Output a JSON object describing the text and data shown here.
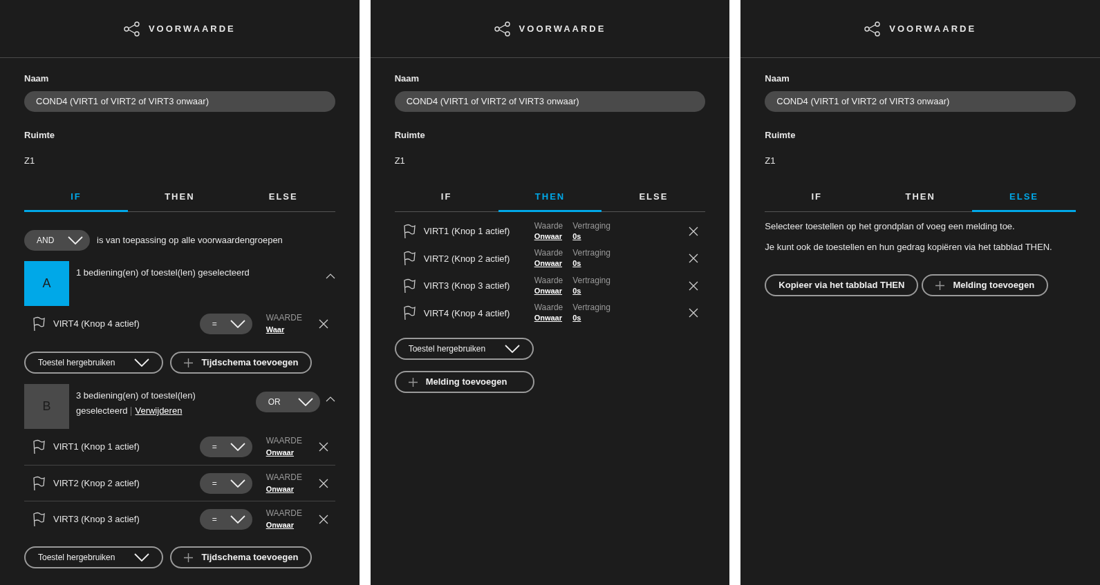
{
  "panels": [
    {
      "kind": "if",
      "title": "VOORWAARDE",
      "name_label": "Naam",
      "name_value": "COND4 (VIRT1 of VIRT2 of VIRT3 onwaar)",
      "room_label": "Ruimte",
      "room_value": "Z1",
      "tabs": [
        {
          "label": "IF",
          "selected": true
        },
        {
          "label": "THEN",
          "selected": false
        },
        {
          "label": "ELSE",
          "selected": false
        }
      ],
      "operator": "AND",
      "operator_text": "is van toepassing op alle voorwaardengroepen",
      "groups": [
        {
          "letter": "A",
          "color": "#00a8e8",
          "summary": "1 bediening(en) of toestel(len) geselecteerd",
          "expanded": true,
          "items": [
            {
              "name": "VIRT4 (Knop 4 actief)",
              "operator": "=",
              "value_label": "WAARDE",
              "value": "Waar"
            }
          ],
          "reuse_button": "Toestel hergebruiken",
          "add_button": "Tijdschema toevoegen"
        },
        {
          "letter": "B",
          "color": "#4a4a4a",
          "summary": "3 bediening(en) of toestel(len) geselecteerd",
          "remove_link": "Verwijderen",
          "operator": "OR",
          "expanded": true,
          "items": [
            {
              "name": "VIRT1 (Knop 1 actief)",
              "operator": "=",
              "value_label": "WAARDE",
              "value": "Onwaar"
            },
            {
              "name": "VIRT2 (Knop 2 actief)",
              "operator": "=",
              "value_label": "WAARDE",
              "value": "Onwaar"
            },
            {
              "name": "VIRT3 (Knop 3 actief)",
              "operator": "=",
              "value_label": "WAARDE",
              "value": "Onwaar"
            }
          ],
          "reuse_button": "Toestel hergebruiken",
          "add_button": "Tijdschema toevoegen"
        }
      ]
    },
    {
      "kind": "then",
      "title": "VOORWAARDE",
      "name_label": "Naam",
      "name_value": "COND4 (VIRT1 of VIRT2 of VIRT3 onwaar)",
      "room_label": "Ruimte",
      "room_value": "Z1",
      "tabs": [
        {
          "label": "IF",
          "selected": false
        },
        {
          "label": "THEN",
          "selected": true
        },
        {
          "label": "ELSE",
          "selected": false
        }
      ],
      "actions": [
        {
          "name": "VIRT1 (Knop 1 actief)",
          "value_label": "Waarde",
          "value": "Onwaar",
          "delay_label": "Vertraging",
          "delay": "0s"
        },
        {
          "name": "VIRT2 (Knop 2 actief)",
          "value_label": "Waarde",
          "value": "Onwaar",
          "delay_label": "Vertraging",
          "delay": "0s"
        },
        {
          "name": "VIRT3 (Knop 3 actief)",
          "value_label": "Waarde",
          "value": "Onwaar",
          "delay_label": "Vertraging",
          "delay": "0s"
        },
        {
          "name": "VIRT4 (Knop 4 actief)",
          "value_label": "Waarde",
          "value": "Onwaar",
          "delay_label": "Vertraging",
          "delay": "0s"
        }
      ],
      "reuse_button": "Toestel hergebruiken",
      "add_button": "Melding toevoegen"
    },
    {
      "kind": "else",
      "title": "VOORWAARDE",
      "name_label": "Naam",
      "name_value": "COND4 (VIRT1 of VIRT2 of VIRT3 onwaar)",
      "room_label": "Ruimte",
      "room_value": "Z1",
      "tabs": [
        {
          "label": "IF",
          "selected": false
        },
        {
          "label": "THEN",
          "selected": false
        },
        {
          "label": "ELSE",
          "selected": true
        }
      ],
      "paragraphs": [
        "Selecteer toestellen op het grondplan of voeg een melding toe.",
        "Je kunt ook de toestellen en hun gedrag kopiëren via het tabblad THEN."
      ],
      "buttons": [
        {
          "kind": "plain",
          "label": "Kopieer via het tabblad THEN"
        },
        {
          "kind": "add",
          "label": "Melding toevoegen"
        }
      ]
    }
  ]
}
